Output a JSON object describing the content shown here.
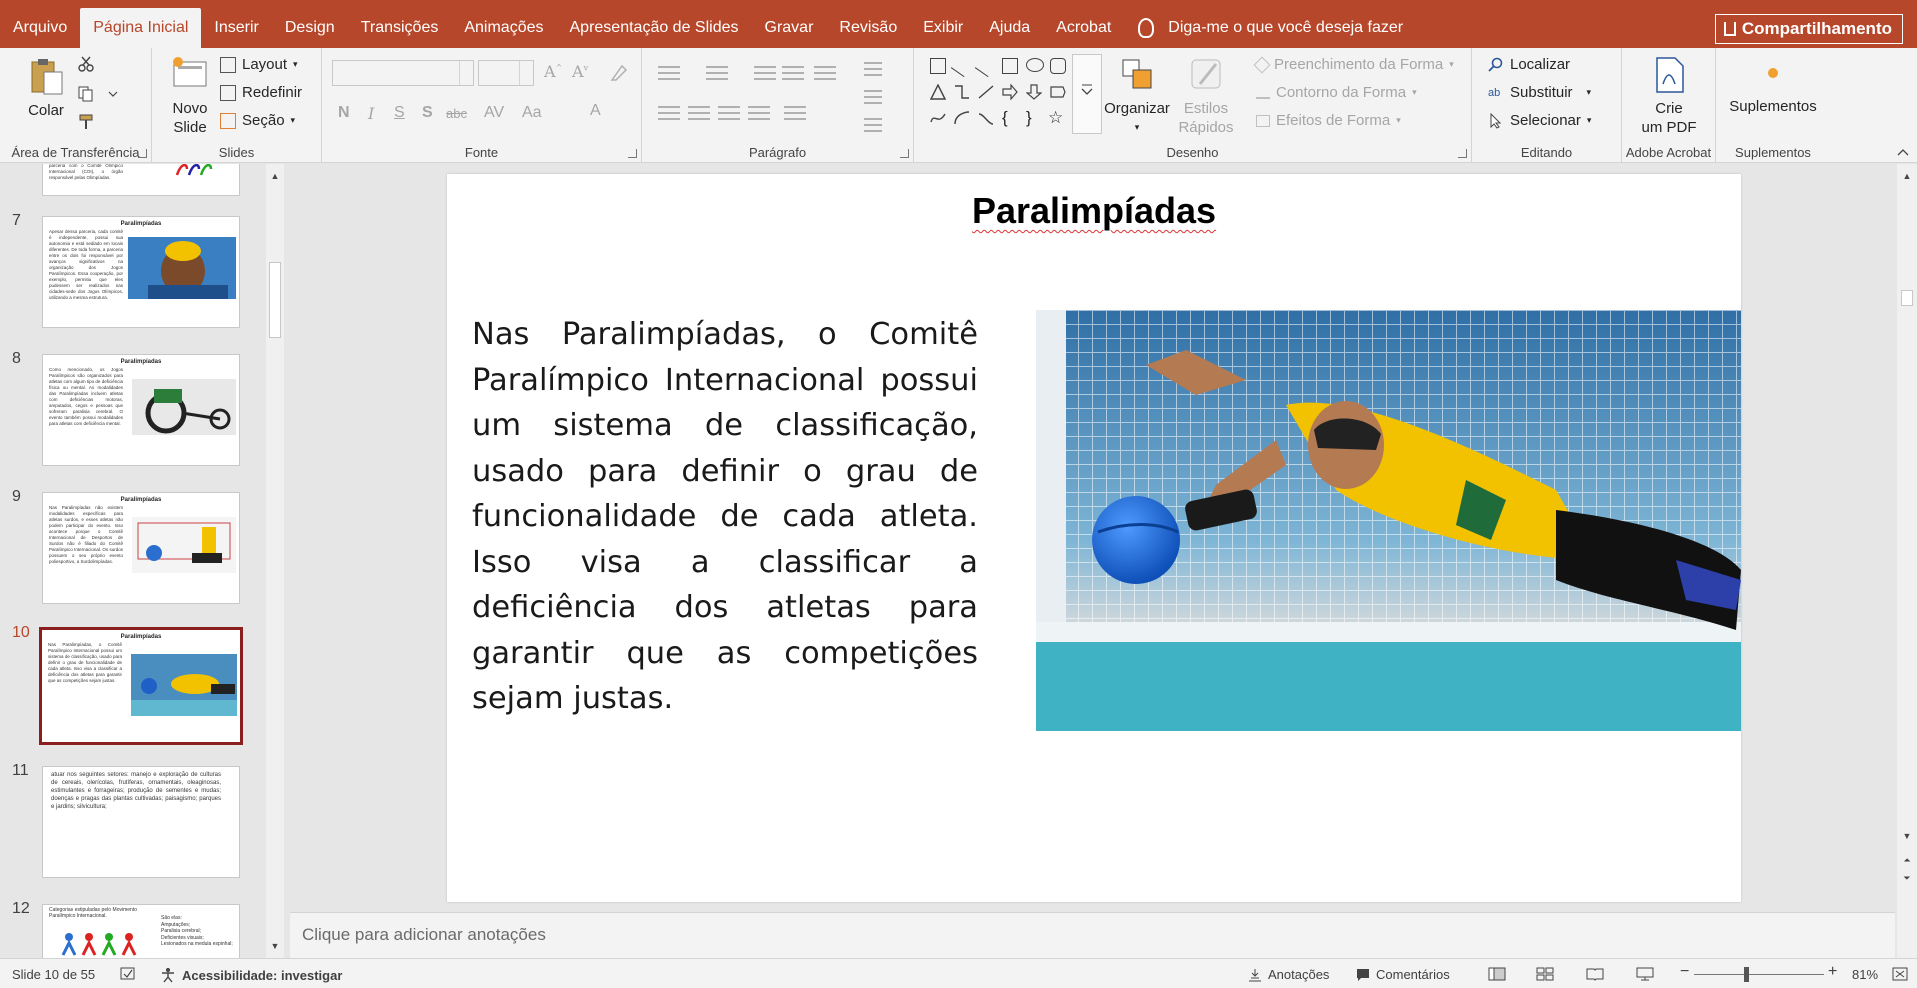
{
  "tabs": [
    "Arquivo",
    "Página Inicial",
    "Inserir",
    "Design",
    "Transições",
    "Animações",
    "Apresentação de Slides",
    "Gravar",
    "Revisão",
    "Exibir",
    "Ajuda",
    "Acrobat"
  ],
  "active_tab": "Página Inicial",
  "tell_me": "Diga-me o que você deseja fazer",
  "share_label": "Compartilhamento",
  "ribbon": {
    "clipboard": {
      "label": "Área de Transferência",
      "paste": "Colar"
    },
    "slides": {
      "label": "Slides",
      "new_slide_1": "Novo",
      "new_slide_2": "Slide",
      "layout": "Layout",
      "reset": "Redefinir",
      "section": "Seção"
    },
    "font": {
      "label": "Fonte"
    },
    "paragraph": {
      "label": "Parágrafo"
    },
    "drawing": {
      "label": "Desenho",
      "arrange": "Organizar",
      "quick_styles_1": "Estilos",
      "quick_styles_2": "Rápidos",
      "shape_fill": "Preenchimento da Forma",
      "shape_outline": "Contorno da Forma",
      "shape_effects": "Efeitos de Forma"
    },
    "editing": {
      "label": "Editando",
      "find": "Localizar",
      "replace": "Substituir",
      "select": "Selecionar"
    },
    "acrobat": {
      "label": "Adobe Acrobat",
      "create_1": "Crie",
      "create_2": "um PDF"
    },
    "addins": {
      "label": "Suplementos",
      "button": "Suplementos"
    }
  },
  "thumbnails": [
    {
      "num": "7",
      "title": "Paralimpíadas",
      "text": "Apesar dessa parceria, cada comitê é independente, possui sua autonomia e está sediado em locais diferentes. De toda forma, a parceria entre os dois foi responsável por avanços significativos na organização dos Jogos Paralímpicos. Essa cooperação, por exemplo, permitiu que eles pudessem ser realizados nas cidades-sede dos Jogos Olímpicos, utilizando a mesma estrutura."
    },
    {
      "num": "8",
      "title": "Paralimpíadas",
      "text": "Como mencionado, os Jogos Paralímpicos são organizados para atletas com algum tipo de deficiência física ou mental. As modalidades das Paralimpíadas incluem atletas com deficiências motoras, amputados, cegos e pessoas que sofreram paralisia cerebral. O evento também possui modalidades para atletas com deficiência mental."
    },
    {
      "num": "9",
      "title": "Paralimpíadas",
      "text": "Nas Paralimpíadas não existem modalidades específicas para atletas surdos, e esses atletas não podem participar do evento. Isso acontece porque o Comitê Internacional de Desportos de Surdos não é filiado do Comitê Paralímpico Internacional. Os surdos possuem o seu próprio evento poliesportivo, a Surdolimpíadas."
    },
    {
      "num": "10",
      "title": "Paralimpíadas",
      "text": "Nas Paralimpíadas, o Comitê Paralímpico Internacional possui um sistema de classificação, usado para definir o grau de funcionalidade de cada atleta. Isso visa a classificar a deficiência dos atletas para garantir que as competições sejam justas."
    },
    {
      "num": "11",
      "title": "",
      "text": "atuar nos seguintes setores: manejo e exploração de culturas de cereais, olerícolas, frutíferas, ornamentais, oleaginosas, estimulantes e forrageiras; produção de sementes e mudas; doenças e pragas das plantas cultivadas; paisagismo; parques e jardins; silvicultura;"
    },
    {
      "num": "12",
      "title": "",
      "text": "Categorias estipuladas pelo Movimento Paralímpico Internacional."
    }
  ],
  "thumb12_list": [
    "São elas:",
    "Amputações;",
    "Paralisia cerebral;",
    "Deficientes visuais;",
    "Lesionados na medula espinhal;"
  ],
  "thumb6_text": "parceria com o Comitê Olímpico Internacional (COI), o órgão responsável pelas Olimpíadas.",
  "slide": {
    "title": "Paralimpíadas",
    "body": "Nas Paralimpíadas, o Comitê Paralímpico Internacional possui um sistema de classificação, usado para definir o grau de funcionalidade de cada atleta. Isso visa a classificar a deficiência dos atletas para garantir que as competições sejam justas."
  },
  "notes_placeholder": "Clique para adicionar anotações",
  "status": {
    "slide_count": "Slide 10 de 55",
    "accessibility": "Acessibilidade: investigar",
    "notes": "Anotações",
    "comments": "Comentários",
    "zoom": "81%"
  },
  "colors": {
    "accent": "#b7472a",
    "selected_thumb": "#8b1e1e"
  }
}
